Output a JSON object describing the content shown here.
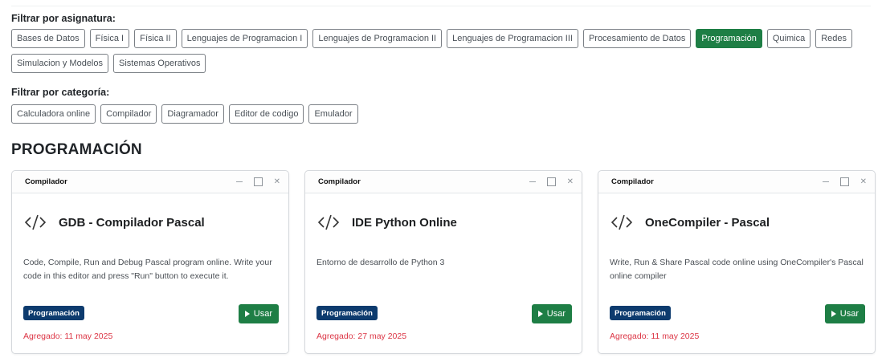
{
  "filters": {
    "subject_label": "Filtrar por asignatura:",
    "subjects": [
      "Bases de Datos",
      "Física I",
      "Física II",
      "Lenguajes de Programacion I",
      "Lenguajes de Programacion II",
      "Lenguajes de Programacion III",
      "Procesamiento de Datos",
      "Programación",
      "Quimica",
      "Redes",
      "Simulacion y Modelos",
      "Sistemas Operativos"
    ],
    "active_subject": "Programación",
    "category_label": "Filtrar por categoría:",
    "categories": [
      "Calculadora online",
      "Compilador",
      "Diagramador",
      "Editor de codigo",
      "Emulador"
    ]
  },
  "section_title": "PROGRAMACIÓN",
  "cards": [
    {
      "category": "Compilador",
      "title": "GDB - Compilador Pascal",
      "description": "Code, Compile, Run and Debug Pascal program online. Write your code in this editor and press \"Run\" button to execute it.",
      "tag": "Programación",
      "button": "Usar",
      "added": "Agregado: 11 may 2025"
    },
    {
      "category": "Compilador",
      "title": "IDE Python Online",
      "description": "Entorno de desarrollo de Python 3",
      "tag": "Programación",
      "button": "Usar",
      "added": "Agregado: 27 may 2025"
    },
    {
      "category": "Compilador",
      "title": "OneCompiler - Pascal",
      "description": "Write, Run & Share Pascal code online using OneCompiler's Pascal online compiler",
      "tag": "Programación",
      "button": "Usar",
      "added": "Agregado: 11 may 2025"
    }
  ],
  "colors": {
    "accent_green": "#1e7e45",
    "tag_navy": "#0d3b6e",
    "date_red": "#dc3545"
  },
  "icons": {
    "card_icon": "code-icon",
    "button_icon": "play-icon",
    "window_controls": [
      "minimize-icon",
      "maximize-icon",
      "close-icon"
    ]
  }
}
